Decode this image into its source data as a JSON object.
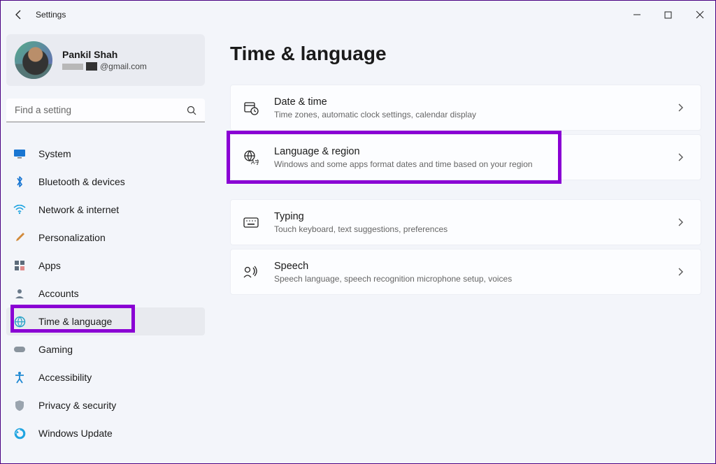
{
  "app": {
    "title": "Settings"
  },
  "profile": {
    "name": "Pankil Shah",
    "email_suffix": "@gmail.com"
  },
  "search": {
    "placeholder": "Find a setting"
  },
  "nav": [
    {
      "key": "system",
      "label": "System"
    },
    {
      "key": "bluetooth",
      "label": "Bluetooth & devices"
    },
    {
      "key": "network",
      "label": "Network & internet"
    },
    {
      "key": "personalization",
      "label": "Personalization"
    },
    {
      "key": "apps",
      "label": "Apps"
    },
    {
      "key": "accounts",
      "label": "Accounts"
    },
    {
      "key": "time-language",
      "label": "Time & language"
    },
    {
      "key": "gaming",
      "label": "Gaming"
    },
    {
      "key": "accessibility",
      "label": "Accessibility"
    },
    {
      "key": "privacy",
      "label": "Privacy & security"
    },
    {
      "key": "windows-update",
      "label": "Windows Update"
    }
  ],
  "page": {
    "title": "Time & language"
  },
  "cards": [
    {
      "key": "date-time",
      "title": "Date & time",
      "desc": "Time zones, automatic clock settings, calendar display"
    },
    {
      "key": "language-region",
      "title": "Language & region",
      "desc": "Windows and some apps format dates and time based on your region"
    },
    {
      "key": "typing",
      "title": "Typing",
      "desc": "Touch keyboard, text suggestions, preferences"
    },
    {
      "key": "speech",
      "title": "Speech",
      "desc": "Speech language, speech recognition microphone setup, voices"
    }
  ]
}
